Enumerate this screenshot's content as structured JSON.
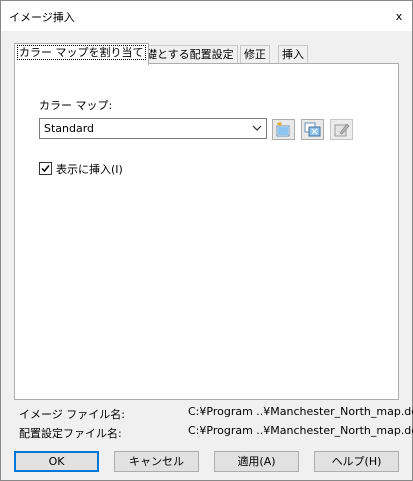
{
  "window": {
    "title": "イメージ挿入",
    "close_glyph": "x"
  },
  "tabs": [
    {
      "label": "カラー マップを割り当て",
      "active": true
    },
    {
      "label": "基礎とする配置設定",
      "active": false
    },
    {
      "label": "修正",
      "active": false
    },
    {
      "label": "挿入",
      "active": false
    }
  ],
  "colormap": {
    "label": "カラー マップ:",
    "selected": "Standard",
    "buttons": [
      {
        "icon": "new-colormap-icon",
        "enabled": true
      },
      {
        "icon": "copy-colormap-icon",
        "enabled": true
      },
      {
        "icon": "edit-colormap-icon",
        "enabled": false
      }
    ]
  },
  "show_insert": {
    "label": "表示に挿入(I)",
    "checked": true
  },
  "files": {
    "image_label": "イメージ ファイル名:",
    "image_value": "C:¥Program ..¥Manchester_North_map.dem",
    "placement_label": "配置設定ファイル名:",
    "placement_value": "C:¥Program ..¥Manchester_North_map.dem"
  },
  "buttons": {
    "ok": "OK",
    "cancel": "キャンセル",
    "apply": "適用(A)",
    "help": "ヘルプ(H)"
  },
  "colors": {
    "accent": "#0078d7",
    "panel_bg": "#ffffff",
    "window_bg": "#f0f0f0"
  }
}
